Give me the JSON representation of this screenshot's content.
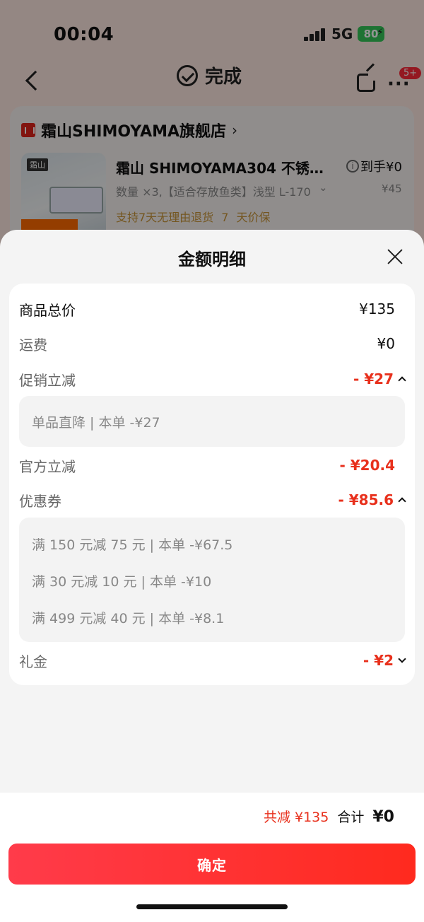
{
  "status_bar": {
    "time": "00:04",
    "network": "5G",
    "battery": "80"
  },
  "nav": {
    "title": "完成",
    "badge": "5+"
  },
  "store": {
    "name": "霜山SHIMOYAMA旗舰店",
    "chevron": "›"
  },
  "product": {
    "title": "霜山 SHIMOYAMA304 不锈钢...",
    "price_label": "到手¥0",
    "spec": "数量 ×3,【适合存放鱼类】浅型 L-170",
    "original_price": "¥45",
    "service": "支持7天无理由退货   7 天价保",
    "image_tag": "霜山"
  },
  "sheet": {
    "title": "金额明细",
    "rows": {
      "goods_total": {
        "label": "商品总价",
        "amount": "¥135"
      },
      "shipping": {
        "label": "运费",
        "amount": "¥0"
      },
      "promo": {
        "label": "促销立减",
        "amount": "- ¥27"
      },
      "official": {
        "label": "官方立减",
        "amount": "- ¥20.4"
      },
      "coupon": {
        "label": "优惠券",
        "amount": "- ¥85.6"
      },
      "gift": {
        "label": "礼金",
        "amount": "- ¥2"
      }
    },
    "promo_details": [
      "单品直降 | 本单 -¥27"
    ],
    "coupon_details": [
      "满 150 元减 75 元 | 本单 -¥67.5",
      "满 30 元减 10 元 | 本单 -¥10",
      "满 499 元减 40 元 | 本单 -¥8.1"
    ]
  },
  "footer": {
    "discount_total": "共减 ¥135",
    "total_label": "合计",
    "total_value": "¥0",
    "confirm": "确定"
  },
  "colors": {
    "accent_red": "#e8301c",
    "button_start": "#ff3b4a",
    "button_end": "#ff2a1e"
  }
}
